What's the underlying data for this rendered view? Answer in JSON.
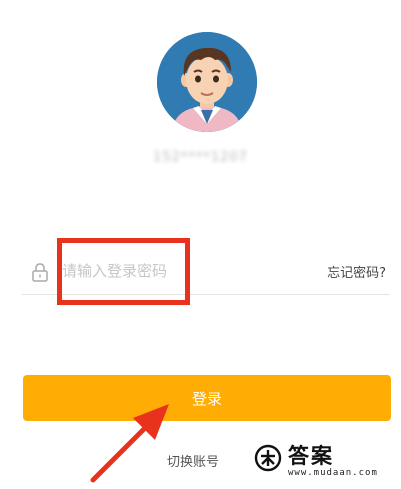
{
  "user": {
    "account_masked": "152****1207"
  },
  "password": {
    "placeholder": "请输入登录密码",
    "forgot_label": "忘记密码?"
  },
  "actions": {
    "login_label": "登录",
    "switch_label": "切换账号"
  },
  "watermark": {
    "title": "答案",
    "url": "www.mudaan.com"
  },
  "colors": {
    "accent": "#ffad05",
    "annotation": "#e8321c",
    "avatar_bg": "#2f7bb2"
  },
  "icons": {
    "lock": "lock-icon",
    "avatar": "avatar",
    "pointer": "arrow-icon"
  }
}
